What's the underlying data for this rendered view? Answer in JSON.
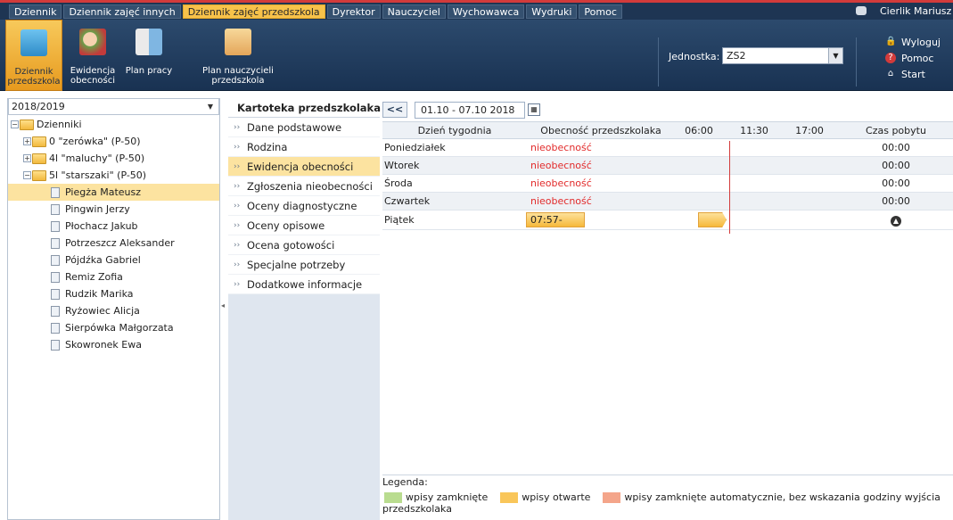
{
  "topbar": {
    "tabs": [
      "Dziennik",
      "Dziennik zajęć innych",
      "Dziennik zajęć przedszkola",
      "Dyrektor",
      "Nauczyciel",
      "Wychowawca",
      "Wydruki",
      "Pomoc"
    ],
    "active_tab": "Dziennik zajęć przedszkola",
    "user": "Cierlik Mariusz [M"
  },
  "toolbar": {
    "buttons": [
      {
        "label1": "Dziennik",
        "label2": "przedszkola"
      },
      {
        "label1": "Ewidencja",
        "label2": "obecności"
      },
      {
        "label1": "Plan pracy",
        "label2": ""
      },
      {
        "label1": "Plan nauczycieli",
        "label2": "przedszkola"
      }
    ],
    "unit_label": "Jednostka:",
    "unit_value": "ZS2",
    "logout": "Wyloguj",
    "help": "Pomoc",
    "start": "Start"
  },
  "left": {
    "year": "2018/2019",
    "root": "Dzienniki",
    "groups": [
      "0 \"zerówka\" (P-50)",
      "4l \"maluchy\" (P-50)",
      "5l \"starszaki\" (P-50)"
    ],
    "children": [
      "Piegża Mateusz",
      "Pingwin Jerzy",
      "Płochacz Jakub",
      "Potrzeszcz Aleksander",
      "Pójdźka Gabriel",
      "Remiz Zofia",
      "Rudzik Marika",
      "Ryżowiec Alicja",
      "Sierpówka Małgorzata",
      "Skowronek Ewa"
    ],
    "selected_child": "Piegża Mateusz"
  },
  "mid": {
    "title": "Kartoteka przedszkolaka",
    "items": [
      "Dane podstawowe",
      "Rodzina",
      "Ewidencja obecności",
      "Zgłoszenia nieobecności",
      "Oceny diagnostyczne",
      "Oceny opisowe",
      "Ocena gotowości",
      "Specjalne potrzeby",
      "Dodatkowe informacje"
    ],
    "active_item": "Ewidencja obecności"
  },
  "right": {
    "nav_prev": "<<",
    "date_range": "01.10 - 07.10 2018",
    "headers": {
      "day": "Dzień tygodnia",
      "presence": "Obecność przedszkolaka",
      "t1": "06:00",
      "t2": "11:30",
      "t3": "17:00",
      "time": "Czas pobytu"
    },
    "rows": [
      {
        "day": "Poniedziałek",
        "presence": "nieobecność",
        "time": "00:00"
      },
      {
        "day": "Wtorek",
        "presence": "nieobecność",
        "time": "00:00"
      },
      {
        "day": "Środa",
        "presence": "nieobecność",
        "time": "00:00"
      },
      {
        "day": "Czwartek",
        "presence": "nieobecność",
        "time": "00:00"
      },
      {
        "day": "Piątek",
        "presence": "07:57-",
        "time": ""
      }
    ],
    "legend_title": "Legenda:",
    "legend": [
      {
        "label": "wpisy zamknięte",
        "color": "#b9dc8f"
      },
      {
        "label": "wpisy otwarte",
        "color": "#f9c65a"
      },
      {
        "label": "wpisy zamknięte automatycznie, bez wskazania godziny wyjścia",
        "color": "#f4a58a"
      }
    ],
    "legend_tail": "przedszkolaka"
  },
  "colors": {
    "accent": "#f7c24a",
    "nav": "#1e3553",
    "absent": "#e22b2b"
  }
}
